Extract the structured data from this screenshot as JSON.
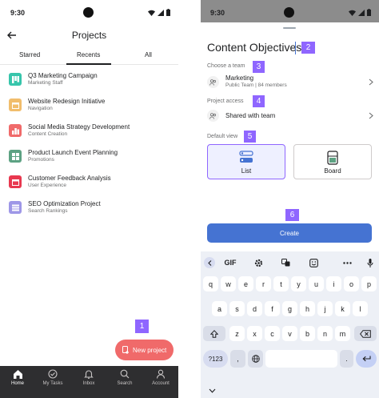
{
  "left": {
    "status": {
      "time": "9:30"
    },
    "title": "Projects",
    "tabs": [
      {
        "label": "Starred"
      },
      {
        "label": "Recents",
        "active": true
      },
      {
        "label": "All"
      }
    ],
    "projects": [
      {
        "name": "Q3 Marketing Campaign",
        "sub": "Marketing Staff",
        "color": "#37c5ab",
        "icon": "board-icon"
      },
      {
        "name": "Website Redesign Initiative",
        "sub": "Navigation",
        "color": "#f1bd6c",
        "icon": "calendar-icon"
      },
      {
        "name": "Social Media Strategy Development",
        "sub": "Content Creation",
        "color": "#f06a6a",
        "icon": "chart-icon"
      },
      {
        "name": "Product Launch Event Planning",
        "sub": "Promotions",
        "color": "#5da283",
        "icon": "board-icon"
      },
      {
        "name": "Customer Feedback Analysis",
        "sub": "User Experience",
        "color": "#e8384f",
        "icon": "calendar-icon"
      },
      {
        "name": "SEO Optimization Project",
        "sub": "Search Rankings",
        "color": "#9e97e7",
        "icon": "list-icon"
      }
    ],
    "fab": {
      "label": "New project",
      "badge": "1"
    },
    "nav": [
      {
        "label": "Home",
        "icon": "home-icon",
        "active": true
      },
      {
        "label": "My Tasks",
        "icon": "check-circle-icon"
      },
      {
        "label": "Inbox",
        "icon": "bell-icon"
      },
      {
        "label": "Search",
        "icon": "search-icon"
      },
      {
        "label": "Account",
        "icon": "person-icon"
      }
    ]
  },
  "right": {
    "status": {
      "time": "9:30"
    },
    "project_name": "Content Objectives",
    "badges": {
      "name": "2",
      "team": "3",
      "access": "4",
      "view": "5",
      "create": "6"
    },
    "team_label": "Choose a team",
    "team": {
      "name": "Marketing",
      "sub": "Public Team | 84 members"
    },
    "access_label": "Project access",
    "access": {
      "name": "Shared with team"
    },
    "view_label": "Default view",
    "views": [
      {
        "label": "List",
        "selected": true
      },
      {
        "label": "Board"
      }
    ],
    "create_label": "Create",
    "keyboard": {
      "gif": "GIF",
      "row1": [
        "q",
        "w",
        "e",
        "r",
        "t",
        "y",
        "u",
        "i",
        "o",
        "p"
      ],
      "row2": [
        "a",
        "s",
        "d",
        "f",
        "g",
        "h",
        "j",
        "k",
        "l"
      ],
      "row3": [
        "z",
        "x",
        "c",
        "v",
        "b",
        "n",
        "m"
      ],
      "num_label": "?123",
      "comma": ",",
      "period": "."
    }
  },
  "colors": {
    "accent": "#4573d2",
    "fab": "#f06a6a",
    "badge": "#8f66ff",
    "nav_bg": "#2e2e30"
  }
}
